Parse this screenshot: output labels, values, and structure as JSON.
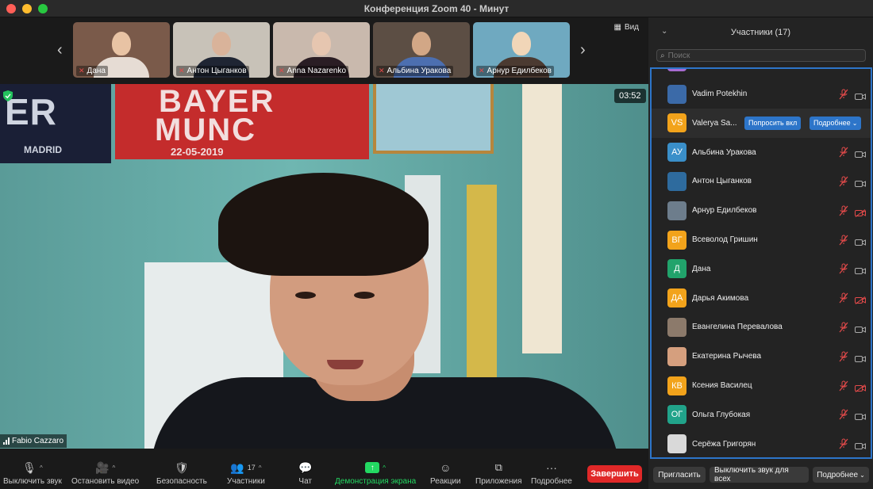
{
  "window": {
    "title": "Конференция Zoom   40 - Минут",
    "traffic_colors": [
      "#ff5f57",
      "#febc2e",
      "#28c840"
    ]
  },
  "top_strip": {
    "view_label": "Вид",
    "thumbnails": [
      {
        "name": "Дана",
        "bg": "#7a5a4a",
        "face": "#e8c3a4",
        "body": "#e6dcd4"
      },
      {
        "name": "Антон Цыганков",
        "bg": "#c8c2b8",
        "face": "#d9b39a",
        "body": "#1f2533"
      },
      {
        "name": "Anna Nazarenko",
        "bg": "#c9b9ad",
        "face": "#e6c6b0",
        "body": "#2a1d24"
      },
      {
        "name": "Альбина Уракова",
        "bg": "#5c4e44",
        "face": "#d2a786",
        "body": "#4c6fb0"
      },
      {
        "name": "Арнур Едилбеков",
        "bg": "#6fa9c0",
        "face": "#f1d6b8",
        "body": "#4b3a31"
      }
    ]
  },
  "main_video": {
    "timer": "03:52",
    "speaker_name": "Fabio Cazzaro",
    "poster_text": "ER",
    "poster_sub": "MADRID",
    "banner_line1": "BAYER",
    "banner_line2": "MUNC",
    "banner_date": "22-05-2019"
  },
  "toolbar": {
    "mute": "Выключить звук",
    "video": "Остановить видео",
    "security": "Безопасность",
    "participants": "Участники",
    "participants_count": "17",
    "chat": "Чат",
    "share": "Демонстрация экрана",
    "reactions": "Реакции",
    "apps": "Приложения",
    "more": "Подробнее",
    "end": "Завершить",
    "share_color": "#23d962"
  },
  "panel": {
    "title": "Участники (17)",
    "search_placeholder": "Поиск",
    "ask_label": "Попросить вкл",
    "more_label": "Подробнее",
    "participants": [
      {
        "name": "Vadim Potekhin",
        "avatar_text": "",
        "avatar_color": "#3b6aa8",
        "mic_off": true,
        "cam_off": false
      },
      {
        "name": "Valerya Sa...",
        "avatar_text": "VS",
        "avatar_color": "#f2a31b",
        "mic_off": false,
        "cam_off": false
      },
      {
        "name": "Альбина Уракова",
        "avatar_text": "АУ",
        "avatar_color": "#3a8fc9",
        "mic_off": true,
        "cam_off": false
      },
      {
        "name": "Антон Цыганков",
        "avatar_text": "",
        "avatar_color": "#2e6b9e",
        "mic_off": true,
        "cam_off": false
      },
      {
        "name": "Арнур Едилбеков",
        "avatar_text": "",
        "avatar_color": "#6d7d8c",
        "mic_off": true,
        "cam_off": true
      },
      {
        "name": "Всеволод Гришин",
        "avatar_text": "ВГ",
        "avatar_color": "#f2a31b",
        "mic_off": true,
        "cam_off": false
      },
      {
        "name": "Дана",
        "avatar_text": "Д",
        "avatar_color": "#21a36b",
        "mic_off": true,
        "cam_off": false
      },
      {
        "name": "Дарья Акимова",
        "avatar_text": "ДА",
        "avatar_color": "#f2a31b",
        "mic_off": true,
        "cam_off": true
      },
      {
        "name": "Евангелина Перевалова",
        "avatar_text": "",
        "avatar_color": "#8c7a6b",
        "mic_off": true,
        "cam_off": false
      },
      {
        "name": "Екатерина Рычева",
        "avatar_text": "",
        "avatar_color": "#d59f7e",
        "mic_off": true,
        "cam_off": false
      },
      {
        "name": "Ксения Василец",
        "avatar_text": "КВ",
        "avatar_color": "#f2a31b",
        "mic_off": true,
        "cam_off": true
      },
      {
        "name": "Ольга Глубокая",
        "avatar_text": "ОГ",
        "avatar_color": "#21a38a",
        "mic_off": true,
        "cam_off": false
      },
      {
        "name": "Серёжа Григорян",
        "avatar_text": "",
        "avatar_color": "#d9d9d9",
        "mic_off": true,
        "cam_off": false
      }
    ],
    "invite": "Пригласить",
    "mute_all": "Выключить звук для всех",
    "more": "Подробнее"
  }
}
